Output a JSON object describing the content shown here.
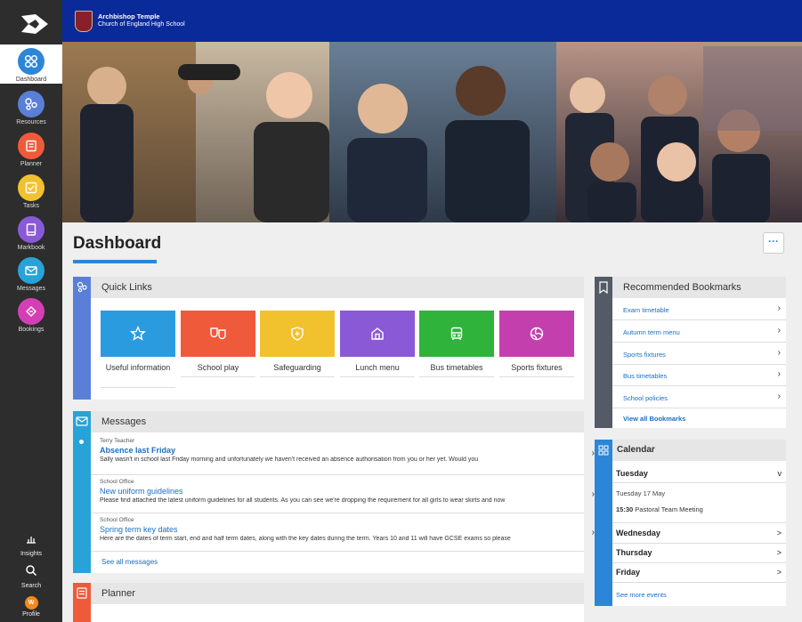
{
  "school": {
    "line1": "Archbishop Temple",
    "line2": "Church of England High School"
  },
  "sidebar": {
    "items": [
      {
        "label": "Dashboard",
        "icon": "grid-icon",
        "color": "#2c86d8"
      },
      {
        "label": "Resources",
        "icon": "resources-icon",
        "color": "#5a7fd6"
      },
      {
        "label": "Planner",
        "icon": "planner-icon",
        "color": "#ef5a3a"
      },
      {
        "label": "Tasks",
        "icon": "tasks-icon",
        "color": "#f2c12e"
      },
      {
        "label": "Markbook",
        "icon": "markbook-icon",
        "color": "#8a5ad6"
      },
      {
        "label": "Messages",
        "icon": "envelope-icon",
        "color": "#27a3d8"
      },
      {
        "label": "Bookings",
        "icon": "bookings-icon",
        "color": "#d43fb6"
      }
    ],
    "bottom": [
      {
        "label": "Insights",
        "icon": "insights-icon"
      },
      {
        "label": "Search",
        "icon": "search-icon"
      },
      {
        "label": "Profile",
        "icon": "avatar-icon",
        "initial": "W"
      }
    ]
  },
  "page": {
    "title": "Dashboard",
    "more": "···"
  },
  "quick_links": {
    "title": "Quick Links",
    "items": [
      {
        "label": "Useful information",
        "color": "#2b9be0",
        "icon": "star-icon"
      },
      {
        "label": "School play",
        "color": "#ef5a3a",
        "icon": "theatre-masks-icon"
      },
      {
        "label": "Safeguarding",
        "color": "#f2c12e",
        "icon": "shield-icon"
      },
      {
        "label": "Lunch menu",
        "color": "#8a5ad6",
        "icon": "home-icon"
      },
      {
        "label": "Bus timetables",
        "color": "#2fb33a",
        "icon": "bus-icon"
      },
      {
        "label": "Sports fixtures",
        "color": "#c43fae",
        "icon": "volleyball-icon"
      }
    ]
  },
  "messages": {
    "title": "Messages",
    "items": [
      {
        "from": "Terry Teacher",
        "title": "Absence last Friday",
        "body": "Sally wasn't in school last Friday morning and unfortunately we haven't received an absence authorisation from you or her yet. Would you",
        "unread": true
      },
      {
        "from": "School Office",
        "title": "New uniform guidelines",
        "body": "Please find attached the latest uniform guidelines for all students. As you can see we're dropping the requirement for all girls to wear skirts and now",
        "unread": false
      },
      {
        "from": "School Office",
        "title": "Spring term key dates",
        "body": "Here are the dates of term start, end and half term dates, along with the key dates during the term. Years 10 and 11 will have GCSE exams so please",
        "unread": false
      }
    ],
    "see_all": "See all messages"
  },
  "planner": {
    "title": "Planner"
  },
  "bookmarks": {
    "title": "Recommended Bookmarks",
    "items": [
      "Exam timetable",
      "Autumn term menu",
      "Sports fixtures",
      "Bus timetables",
      "School policies"
    ],
    "view_all": "View all Bookmarks"
  },
  "calendar": {
    "title": "Calendar",
    "days": [
      {
        "day": "Tuesday",
        "chevron": "v",
        "date": "Tuesday 17 May",
        "event_time": "15:30",
        "event_name": "Pastoral Team Meeting"
      },
      {
        "day": "Wednesday",
        "chevron": ">"
      },
      {
        "day": "Thursday",
        "chevron": ">"
      },
      {
        "day": "Friday",
        "chevron": ">"
      }
    ],
    "see_more": "See more events"
  },
  "colors": {
    "topbar": "#0a2a9a",
    "sidebar": "#2d2d2d",
    "accent": "#2c86d8",
    "link": "#1a6fc4"
  }
}
